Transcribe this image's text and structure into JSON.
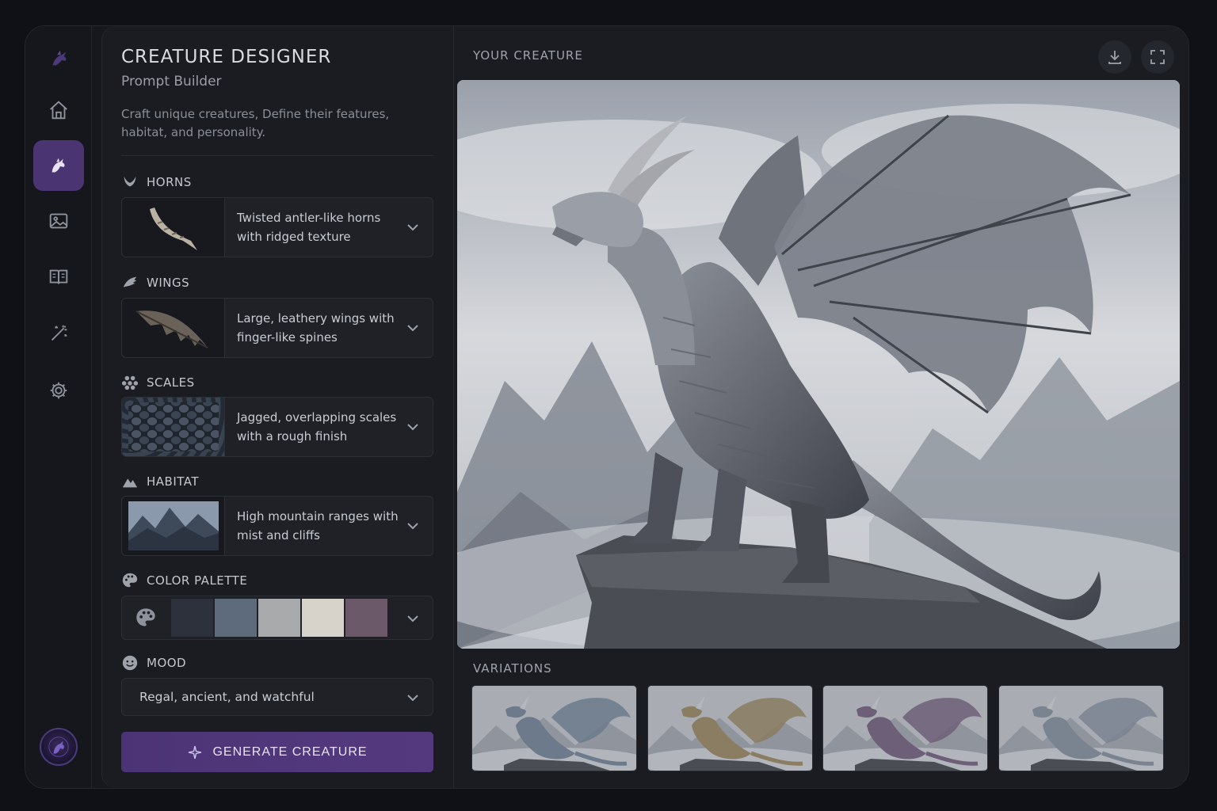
{
  "app": {
    "title": "CREATURE DESIGNER",
    "subtitle": "Prompt Builder",
    "description": "Craft unique creatures, Define their features, habitat, and personality."
  },
  "sidebar": {
    "items": [
      {
        "icon": "dragon-logo-icon",
        "active": false
      },
      {
        "icon": "home-icon",
        "active": false
      },
      {
        "icon": "creature-icon",
        "active": true
      },
      {
        "icon": "image-icon",
        "active": false
      },
      {
        "icon": "book-icon",
        "active": false
      },
      {
        "icon": "magic-wand-icon",
        "active": false
      },
      {
        "icon": "gear-icon",
        "active": false
      }
    ],
    "avatar_icon": "dragon-emblem-icon"
  },
  "sections": {
    "horns": {
      "label": "HORNS",
      "value": "Twisted antler-like horns with ridged texture",
      "icon": "horns-icon"
    },
    "wings": {
      "label": "WINGS",
      "value": "Large, leathery wings with finger-like spines",
      "icon": "wing-icon"
    },
    "scales": {
      "label": "SCALES",
      "value": "Jagged, overlapping scales with a rough finish",
      "icon": "scales-icon"
    },
    "habitat": {
      "label": "HABITAT",
      "value": "High mountain ranges with mist and cliffs",
      "icon": "mountain-icon"
    },
    "palette": {
      "label": "COLOR PALETTE",
      "icon": "palette-icon",
      "swatches": [
        "#2c313b",
        "#5e6b7c",
        "#a9aaab",
        "#d7d2ca",
        "#6b5868"
      ]
    },
    "mood": {
      "label": "MOOD",
      "value": "Regal, ancient, and watchful",
      "icon": "smile-icon"
    }
  },
  "generate_label": "GENERATE CREATURE",
  "preview": {
    "label": "YOUR CREATURE",
    "variations_label": "VARIATIONS",
    "variation_tints": [
      "#6c7a8c",
      "#8a7d62",
      "#6d5f78",
      "#7a8490"
    ]
  },
  "colors": {
    "accent": "#4b3475",
    "background": "#0f1116",
    "panel": "#1a1c21"
  }
}
